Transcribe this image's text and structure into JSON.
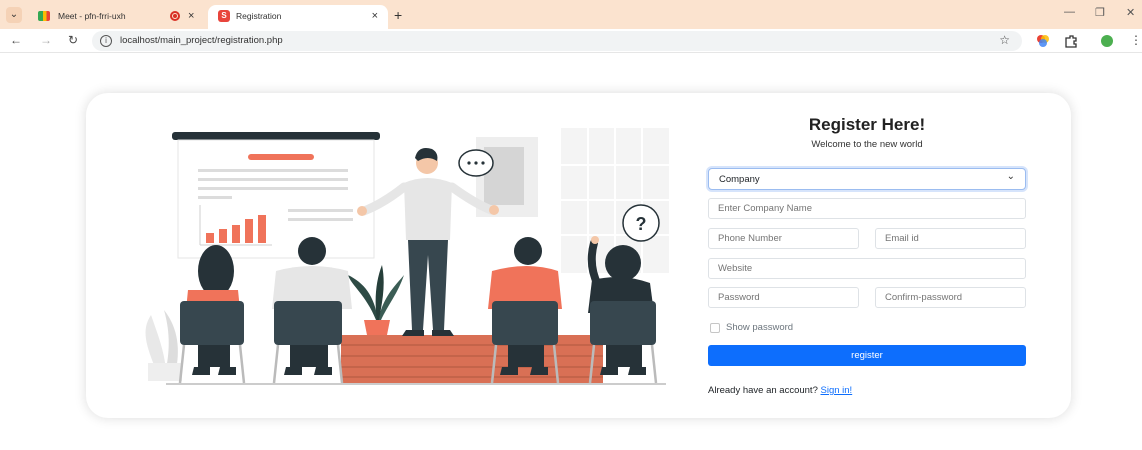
{
  "browser": {
    "tabs": [
      {
        "label": "Meet - pfn-frri-uxh"
      },
      {
        "label": "Registration"
      }
    ],
    "url": "localhost/main_project/registration.php",
    "colors": {
      "tab_bar": "#fbe3cf",
      "accent": "#0d6efd"
    }
  },
  "form": {
    "title": "Register Here!",
    "subtitle": "Welcome to the new world",
    "account_type": {
      "selected": "Company"
    },
    "company_name": {
      "placeholder": "Enter Company Name"
    },
    "phone": {
      "placeholder": "Phone Number"
    },
    "email": {
      "placeholder": "Email id"
    },
    "website": {
      "placeholder": "Website"
    },
    "password": {
      "placeholder": "Password"
    },
    "confirm_password": {
      "placeholder": "Confirm-password"
    },
    "show_password_label": "Show password",
    "submit_label": "register",
    "footer_text": "Already have an account?",
    "signin_link": "Sign in!"
  },
  "illustration": {
    "speech_question": "?"
  }
}
